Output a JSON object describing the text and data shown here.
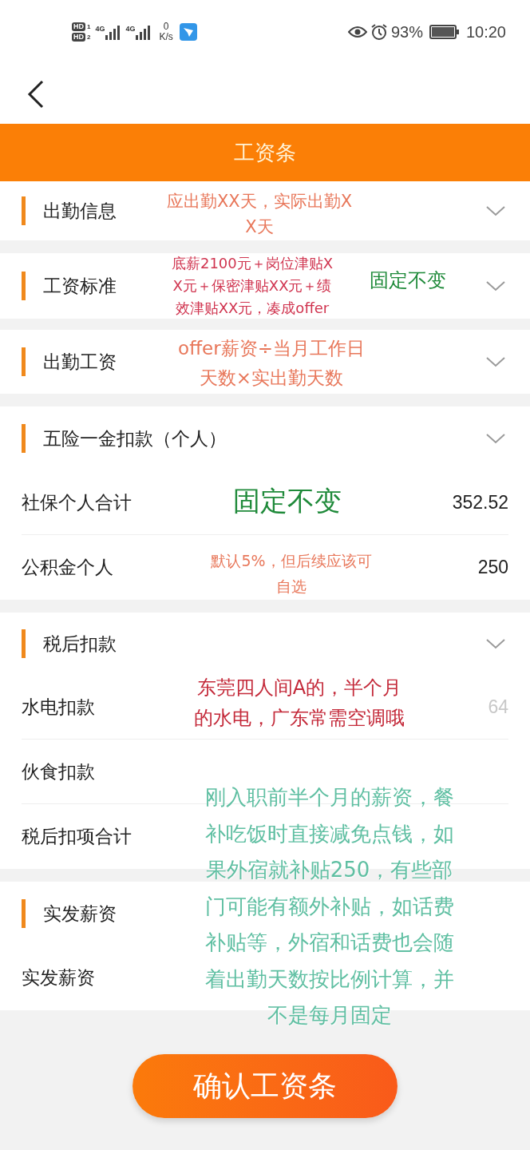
{
  "status_bar": {
    "sims": [
      {
        "badge": "HD",
        "slot": "1"
      },
      {
        "badge": "HD",
        "slot": "2"
      }
    ],
    "networks": [
      "4G",
      "4G"
    ],
    "speed_value": "0",
    "speed_unit": "K/s",
    "battery": "93%",
    "time": "10:20"
  },
  "title": "工资条",
  "sections": [
    {
      "title": "出勤信息",
      "expandable": true
    },
    {
      "title": "工资标准",
      "expandable": true
    },
    {
      "title": "出勤工资",
      "expandable": true
    },
    {
      "title": "五险一金扣款（个人）",
      "expandable": true,
      "rows": [
        {
          "label": "社保个人合计",
          "value": "352.52",
          "faded": false
        },
        {
          "label": "公积金个人",
          "value": "250",
          "faded": false
        }
      ]
    },
    {
      "title": "税后扣款",
      "expandable": true,
      "rows": [
        {
          "label": "水电扣款",
          "value": "64",
          "faded": true
        },
        {
          "label": "伙食扣款"
        },
        {
          "label": "税后扣项合计"
        }
      ]
    },
    {
      "title": "实发薪资",
      "expandable": false,
      "rows": [
        {
          "label": "实发薪资"
        }
      ]
    }
  ],
  "annotations": [
    {
      "lines": [
        "应出勤XX天，实际出勤X",
        "X天"
      ],
      "color": "#e8775a"
    },
    {
      "lines": [
        "底薪2100元＋岗位津贴X",
        "X元＋保密津贴XX元＋绩",
        "效津贴XX元，凑成offer"
      ],
      "color": "#d0344f"
    },
    {
      "lines": [
        "固定不变"
      ],
      "color": "#1f8a3a"
    },
    {
      "lines": [
        "offer薪资÷当月工作日",
        "天数×实出勤天数"
      ],
      "color": "#e8775a"
    },
    {
      "lines": [
        "固定不变"
      ],
      "color": "#1f8a3a"
    },
    {
      "lines": [
        "默认5%，但后续应该可",
        "自选"
      ],
      "color": "#e8775a"
    },
    {
      "lines": [
        "东莞四人间A的，半个月",
        "的水电，广东常需空调哦"
      ],
      "color": "#c42a3a"
    },
    {
      "lines": [
        "刚入职前半个月的薪资，餐",
        "补吃饭时直接减免点钱，如",
        "果外宿就补贴250，有些部",
        "门可能有额外补贴，如话费",
        "补贴等，外宿和话费也会随",
        "着出勤天数按比例计算，并",
        "不是每月固定"
      ],
      "color": "#5fbfa2"
    }
  ],
  "confirm_button": "确认工资条"
}
